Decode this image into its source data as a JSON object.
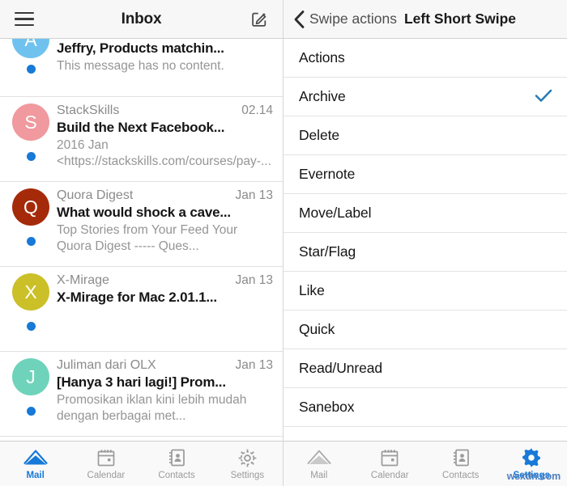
{
  "left_panel": {
    "navbar": {
      "menu_icon": "hamburger-icon",
      "title": "Inbox",
      "compose_icon": "compose-icon"
    },
    "emails": [
      {
        "avatar_letter": "A",
        "avatar_color": "#6FC2EE",
        "sender": "",
        "date": "",
        "subject": "Jeffry, Products matchin...",
        "preview": "This message has no content.",
        "unread": true,
        "partial": true
      },
      {
        "avatar_letter": "S",
        "avatar_color": "#F0999E",
        "sender": "StackSkills",
        "date": "02.14",
        "subject": "Build the Next Facebook...",
        "preview": "2016 Jan <https://stackskills.com/courses/pay-...",
        "unread": true,
        "partial": false
      },
      {
        "avatar_letter": "Q",
        "avatar_color": "#A52A09",
        "sender": "Quora Digest",
        "date": "Jan 13",
        "subject": "What would shock a cave...",
        "preview": "Top Stories from Your Feed Your Quora Digest ----- Ques...",
        "unread": true,
        "partial": false
      },
      {
        "avatar_letter": "X",
        "avatar_color": "#CBC028",
        "sender": "X-Mirage",
        "date": "Jan 13",
        "subject": "X-Mirage for Mac 2.01.1...",
        "preview": "",
        "unread": true,
        "partial": false
      },
      {
        "avatar_letter": "J",
        "avatar_color": "#6FD3BB",
        "sender": "Juliman dari OLX",
        "date": "Jan 13",
        "subject": "[Hanya 3 hari lagi!] Prom...",
        "preview": "Promosikan iklan kini lebih mudah dengan berbagai met...",
        "unread": true,
        "partial": false
      }
    ],
    "tabbar": {
      "tabs": [
        {
          "label": "Mail",
          "icon": "mail-icon",
          "active": true
        },
        {
          "label": "Calendar",
          "icon": "calendar-icon",
          "active": false
        },
        {
          "label": "Contacts",
          "icon": "contacts-icon",
          "active": false
        },
        {
          "label": "Settings",
          "icon": "gear-icon",
          "active": false
        }
      ]
    }
  },
  "right_panel": {
    "navbar": {
      "back_icon": "chevron-left-icon",
      "back_label": "Swipe actions",
      "title": "Left Short Swipe"
    },
    "settings_items": [
      {
        "label": "Actions",
        "checked": false
      },
      {
        "label": "Archive",
        "checked": true
      },
      {
        "label": "Delete",
        "checked": false
      },
      {
        "label": "Evernote",
        "checked": false
      },
      {
        "label": "Move/Label",
        "checked": false
      },
      {
        "label": "Star/Flag",
        "checked": false
      },
      {
        "label": "Like",
        "checked": false
      },
      {
        "label": "Quick",
        "checked": false
      },
      {
        "label": "Read/Unread",
        "checked": false
      },
      {
        "label": "Sanebox",
        "checked": false
      }
    ],
    "check_color": "#2b7cb5",
    "tabbar": {
      "tabs": [
        {
          "label": "Mail",
          "icon": "mail-icon",
          "active": false
        },
        {
          "label": "Calendar",
          "icon": "calendar-icon",
          "active": false
        },
        {
          "label": "Contacts",
          "icon": "contacts-icon",
          "active": false
        },
        {
          "label": "Settings",
          "icon": "gear-icon",
          "active": true
        }
      ]
    },
    "watermark": "wsxdn.com"
  }
}
